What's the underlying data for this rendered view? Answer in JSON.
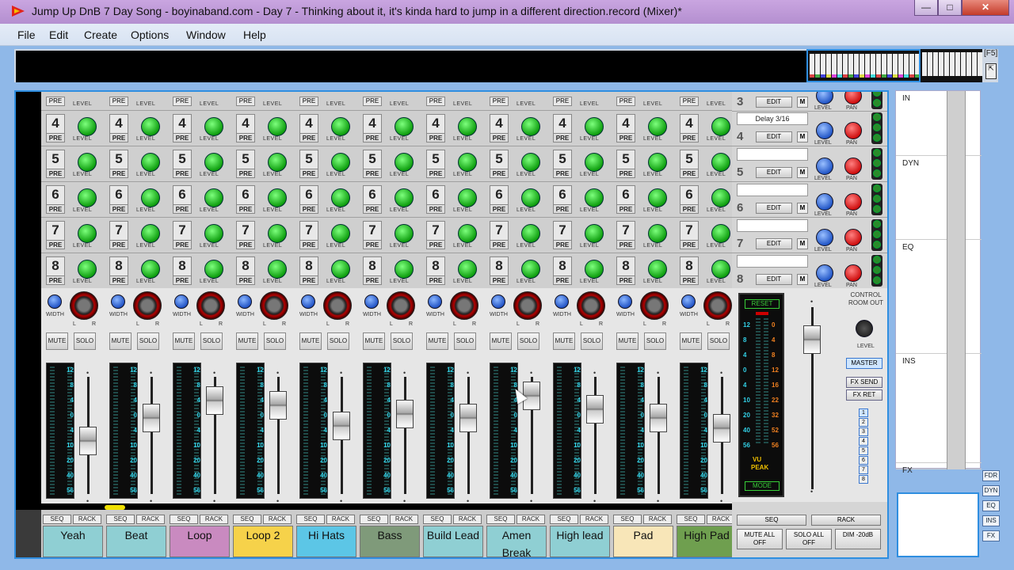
{
  "window": {
    "title": "Jump Up DnB 7 Day Song - boyinaband.com - Day 7 - Thinking about it, it's kinda hard to jump in a different direction.record (Mixer)*",
    "min": "—",
    "max": "□",
    "close": "✕"
  },
  "menu": [
    "File",
    "Edit",
    "Create",
    "Options",
    "Window",
    "Help"
  ],
  "f5_label": "F5",
  "send_rows": [
    {
      "num": "4",
      "pre": "PRE",
      "level": "LEVEL"
    },
    {
      "num": "5",
      "pre": "PRE",
      "level": "LEVEL"
    },
    {
      "num": "6",
      "pre": "PRE",
      "level": "LEVEL"
    },
    {
      "num": "7",
      "pre": "PRE",
      "level": "LEVEL"
    },
    {
      "num": "8",
      "pre": "PRE",
      "level": "LEVEL"
    }
  ],
  "top_partial": {
    "pre": "PRE",
    "level": "LEVEL"
  },
  "strip_labels": {
    "width": "WIDTH",
    "l": "L",
    "r": "R",
    "mute": "MUTE",
    "solo": "SOLO",
    "seq": "SEQ",
    "rack": "RACK"
  },
  "meter_scale": [
    "12",
    "8",
    "4",
    "0",
    "4",
    "10",
    "20",
    "40",
    "56"
  ],
  "channels": [
    {
      "name": "Yeah",
      "color": "#8fcfd3",
      "fader": 0.45
    },
    {
      "name": "Beat",
      "color": "#8fcfd3",
      "fader": 0.65
    },
    {
      "name": "Loop",
      "color": "#c98ac0",
      "fader": 0.8
    },
    {
      "name": "Loop 2",
      "color": "#f6d24a",
      "fader": 0.76
    },
    {
      "name": "Hi Hats",
      "color": "#5cc6e6",
      "fader": 0.58
    },
    {
      "name": "Bass",
      "color": "#7f9a7a",
      "fader": 0.68
    },
    {
      "name": "Build Lead",
      "color": "#8fcfd3",
      "fader": 0.65
    },
    {
      "name": "Amen Break",
      "color": "#8fcfd3",
      "fader": 0.84
    },
    {
      "name": "High lead",
      "color": "#8fcfd3",
      "fader": 0.72
    },
    {
      "name": "Pad",
      "color": "#f8e6b8",
      "fader": 0.65
    },
    {
      "name": "High Pad",
      "color": "#6f9f4f",
      "fader": 0.56
    }
  ],
  "fx_returns": [
    {
      "num": "3",
      "name": "",
      "edit": "EDIT",
      "m": "M"
    },
    {
      "num": "4",
      "name": "Delay 3/16",
      "edit": "EDIT",
      "m": "M"
    },
    {
      "num": "5",
      "name": "",
      "edit": "EDIT",
      "m": "M"
    },
    {
      "num": "6",
      "name": "",
      "edit": "EDIT",
      "m": "M"
    },
    {
      "num": "7",
      "name": "",
      "edit": "EDIT",
      "m": "M"
    },
    {
      "num": "8",
      "name": "",
      "edit": "EDIT",
      "m": "M"
    }
  ],
  "fx_knob_labels": {
    "level": "LEVEL",
    "pan": "PAN"
  },
  "master": {
    "reset": "RESET",
    "mode": "MODE",
    "vu": "VU",
    "peak": "PEAK",
    "left_scale": [
      "12",
      "8",
      "4",
      "0",
      "4",
      "10",
      "20",
      "40",
      "56"
    ],
    "right_scale": [
      "0",
      "4",
      "8",
      "12",
      "16",
      "22",
      "32",
      "52",
      "56"
    ],
    "control_room": "CONTROL ROOM OUT",
    "cr_level": "LEVEL",
    "master_btn": "MASTER",
    "fx_send": "FX SEND",
    "fx_ret": "FX RET",
    "nums": [
      "1",
      "2",
      "3",
      "4",
      "5",
      "6",
      "7",
      "8"
    ],
    "seq": "SEQ",
    "rack": "RACK",
    "mute_all": "MUTE ALL OFF",
    "solo_all": "SOLO ALL OFF",
    "dim": "DIM -20dB",
    "fader": 0.82
  },
  "overview": {
    "sections": [
      "IN",
      "DYN",
      "EQ",
      "INS",
      "FX"
    ],
    "nav": [
      "FDR",
      "DYN",
      "EQ",
      "INS",
      "FX"
    ]
  }
}
